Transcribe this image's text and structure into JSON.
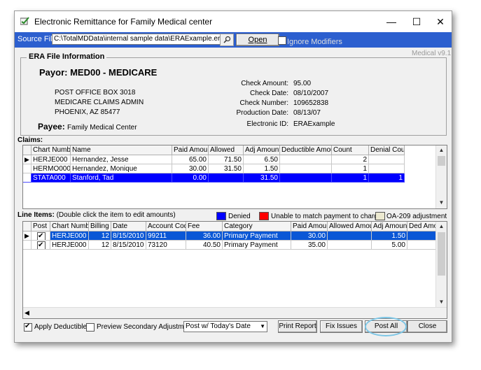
{
  "window": {
    "title": "Electronic Remittance for Family Medical center",
    "controls": {
      "minimize": "—",
      "maximize": "☐",
      "close": "✕"
    }
  },
  "source": {
    "label": "Source File:",
    "path": "C:\\TotalMDData\\internal sample data\\ERAExample.era",
    "browse_icon": "search-icon",
    "open_label": "Open",
    "ignore_modifiers_label": "Ignore Modifiers",
    "ignore_modifiers_checked": false
  },
  "version": "Medical v9.1",
  "era": {
    "section_title": "ERA File Information",
    "payor_label": "Payor:",
    "payor_value": "MED00 - MEDICARE",
    "address": [
      "POST OFFICE BOX 3018",
      "MEDICARE CLAIMS ADMIN",
      "PHOENIX, AZ  85477"
    ],
    "payee_label": "Payee:",
    "payee_value": "Family Medical Center",
    "details": [
      {
        "label": "Check Amount:",
        "value": "95.00"
      },
      {
        "label": "Check Date:",
        "value": "08/10/2007"
      },
      {
        "label": "Check Number:",
        "value": "109652838"
      },
      {
        "label": "Production Date:",
        "value": "08/13/07"
      },
      {
        "label": "Electronic ID:",
        "value": "ERAExample"
      }
    ]
  },
  "claims": {
    "label": "Claims:",
    "columns": [
      "Chart Number",
      "Name",
      "Paid Amount",
      "Allowed",
      "Adj Amount",
      "Deductible Amount",
      "Count",
      "Denial Count"
    ],
    "rows": [
      {
        "cells": [
          "HERJE000",
          "Hernandez, Jesse",
          "65.00",
          "71.50",
          "6.50",
          "",
          "2",
          ""
        ],
        "pointer": true,
        "selected": false
      },
      {
        "cells": [
          "HERMO000",
          "Hernandez, Monique",
          "30.00",
          "31.50",
          "1.50",
          "",
          "1",
          ""
        ],
        "pointer": false,
        "selected": false
      },
      {
        "cells": [
          "STATA000",
          "Stanford, Tad",
          "0.00",
          "",
          "31.50",
          "",
          "1",
          "1"
        ],
        "pointer": false,
        "selected": true
      }
    ]
  },
  "line_items": {
    "label": "Line Items:",
    "hint": "(Double click the item to edit amounts)",
    "legend": [
      {
        "label": "Denied",
        "color": "#0000ff"
      },
      {
        "label": "Unable to match payment to charge",
        "color": "#ff0000"
      },
      {
        "label": "OA-209 adjustment",
        "color": "#ece9d0"
      }
    ],
    "columns": [
      "Post",
      "Chart Number",
      "Billing",
      "Date",
      "Account Code",
      "Fee",
      "Category",
      "Paid Amount",
      "Allowed Amount",
      "Adj Amount",
      "Ded Amou"
    ],
    "rows": [
      {
        "post": true,
        "cells": [
          "HERJE000",
          "12",
          "8/15/2010",
          "99211",
          "36.00",
          "Primary Payment",
          "30.00",
          "",
          "1.50",
          ""
        ],
        "pointer": true,
        "selected": true
      },
      {
        "post": true,
        "cells": [
          "HERJE000",
          "12",
          "8/15/2010",
          "73120",
          "40.50",
          "Primary Payment",
          "35.00",
          "",
          "5.00",
          ""
        ],
        "pointer": false,
        "selected": false
      }
    ]
  },
  "footer": {
    "apply_deductible_label": "Apply Deductible",
    "apply_deductible_checked": true,
    "preview_secondary_label": "Preview Secondary Adjustments",
    "preview_secondary_checked": false,
    "post_option": "Post w/ Today's Date",
    "print_report": "Print Report",
    "fix_issues": "Fix Issues",
    "post_all": "Post All",
    "close": "Close"
  }
}
